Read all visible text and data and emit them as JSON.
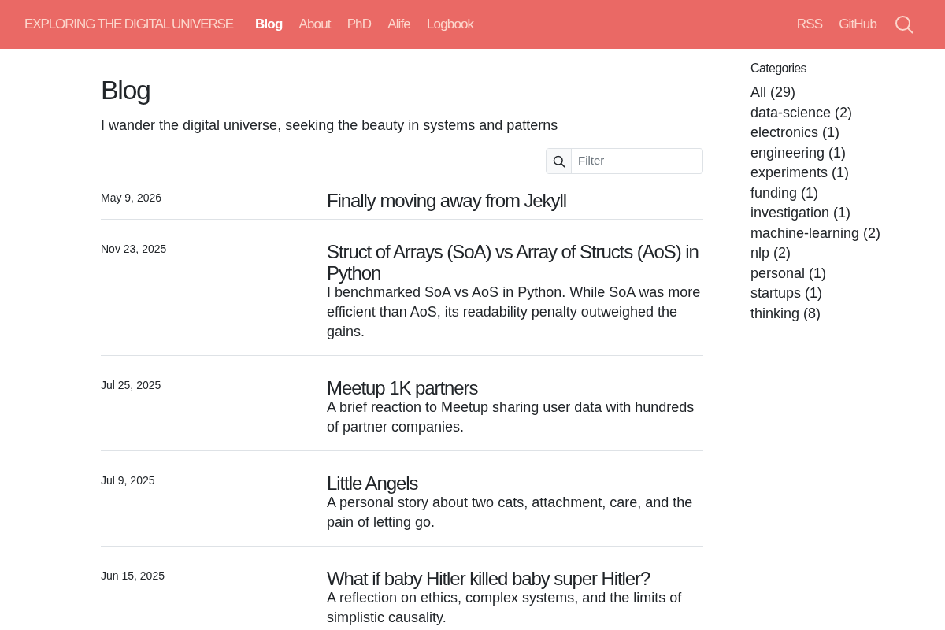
{
  "navbar": {
    "brand": "EXPLORING THE DIGITAL UNIVERSE",
    "links": [
      {
        "label": "Blog",
        "selected": true
      },
      {
        "label": "About",
        "selected": false
      },
      {
        "label": "PhD",
        "selected": false
      },
      {
        "label": "Alife",
        "selected": false
      },
      {
        "label": "Logbook",
        "selected": false
      }
    ],
    "right_links": [
      "RSS",
      "GitHub"
    ]
  },
  "page": {
    "title": "Blog",
    "subtitle": "I wander the digital universe, seeking the beauty in systems and patterns"
  },
  "filter": {
    "placeholder": "Filter"
  },
  "posts": [
    {
      "date": "May 9, 2026",
      "title": "Finally moving away from Jekyll"
    },
    {
      "date": "Nov 23, 2025",
      "title": "Struct of Arrays (SoA) vs Array of Structs (AoS) in Python",
      "description": "I benchmarked SoA vs AoS in Python. While SoA was more efficient than AoS, its readability penalty outweighed the gains."
    },
    {
      "date": "Jul 25, 2025",
      "title": "Meetup 1K partners",
      "description": "A brief reaction to Meetup sharing user data with hundreds of partner companies."
    },
    {
      "date": "Jul 9, 2025",
      "title": "Little Angels",
      "description": "A personal story about two cats, attachment, care, and the pain of letting go."
    },
    {
      "date": "Jun 15, 2025",
      "title": "What if baby Hitler killed baby super Hitler?",
      "description": "A reflection on ethics, complex systems, and the limits of simplistic causality."
    }
  ],
  "sidebar": {
    "title": "Categories",
    "items": [
      "All (29)",
      "data-science (2)",
      "electronics (1)",
      "engineering (1)",
      "experiments (1)",
      "funding (1)",
      "investigation (1)",
      "machine-learning (2)",
      "nlp (2)",
      "personal (1)",
      "startups (1)",
      "thinking (8)"
    ]
  }
}
